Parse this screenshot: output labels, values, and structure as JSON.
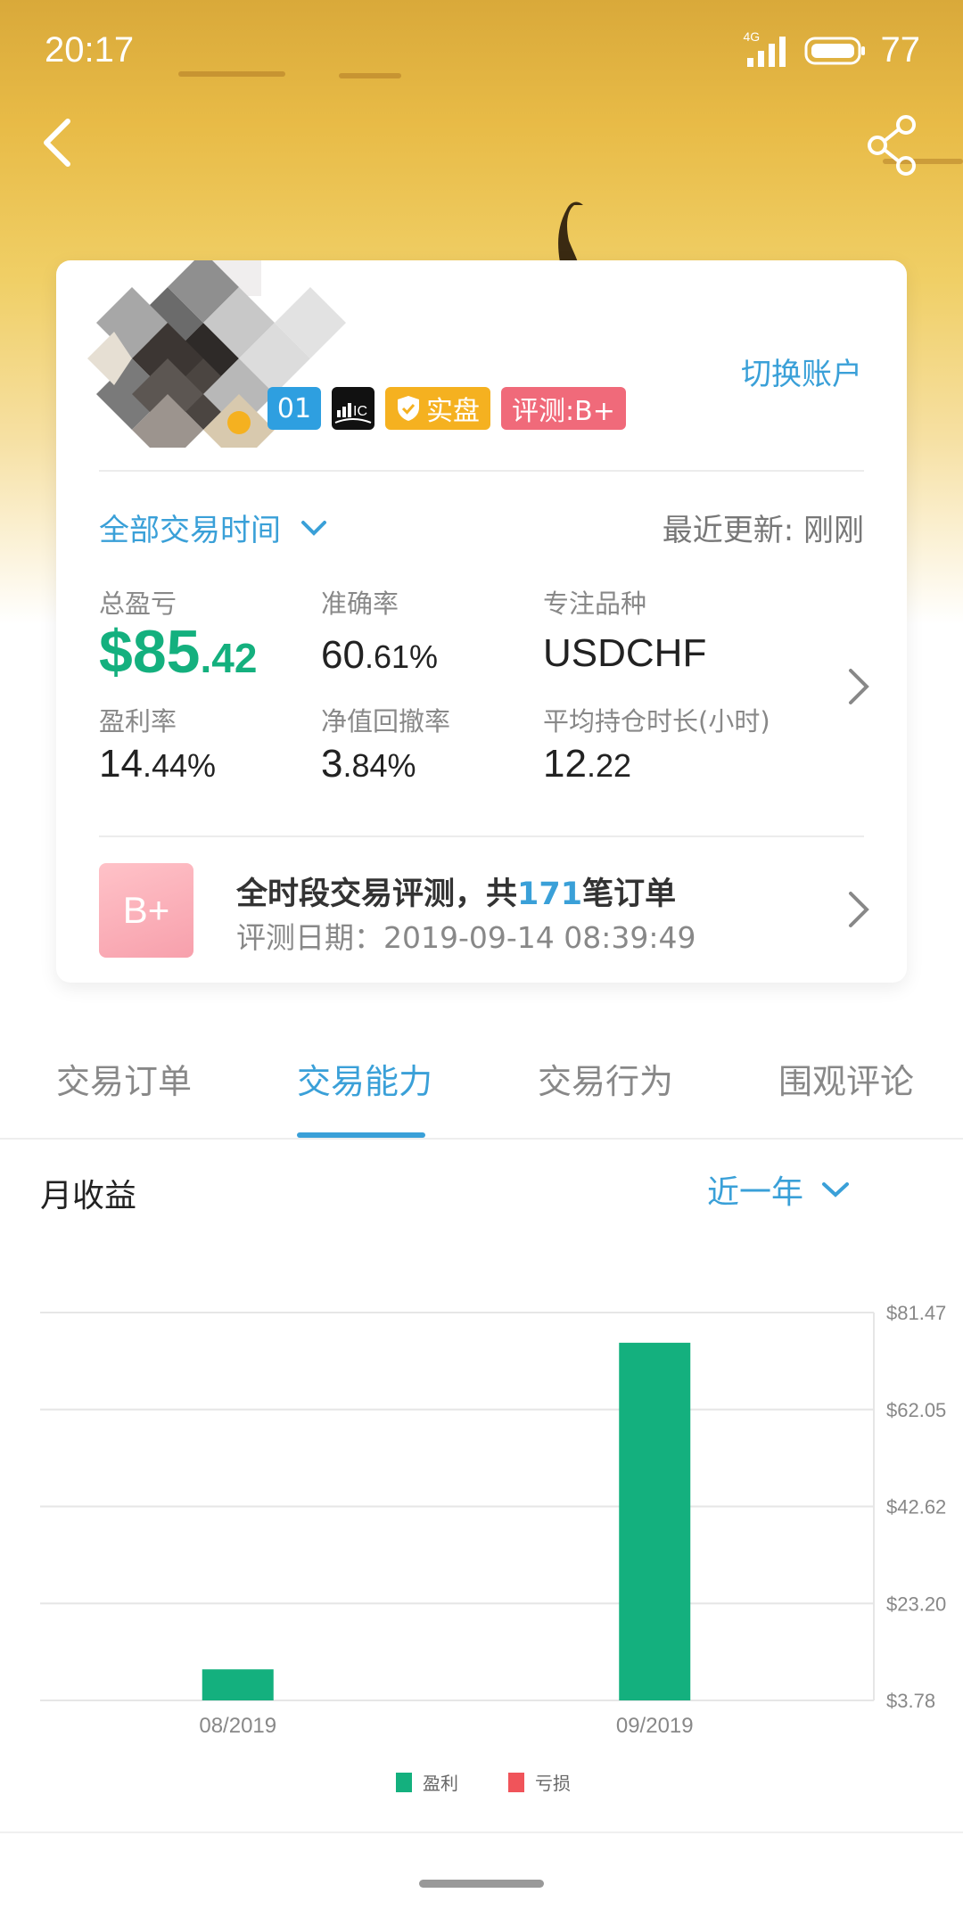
{
  "status": {
    "time": "20:17",
    "network": "4G",
    "battery": "77"
  },
  "account": {
    "badges": {
      "level": "01",
      "broker": "IC",
      "real": "实盘",
      "rating": "评测:B+"
    },
    "switch_label": "切换账户"
  },
  "filter": {
    "time_range": "全部交易时间",
    "last_update": "最近更新: 刚刚"
  },
  "stats": {
    "total_pl": {
      "label": "总盈亏",
      "int": "$85",
      "dec": ".42"
    },
    "accuracy": {
      "label": "准确率",
      "int": "60",
      "dec": ".61%"
    },
    "focus_symbol": {
      "label": "专注品种",
      "value": "USDCHF"
    },
    "profit_rate": {
      "label": "盈利率",
      "int": "14",
      "dec": ".44%"
    },
    "drawdown": {
      "label": "净值回撤率",
      "int": "3",
      "dec": ".84%"
    },
    "avg_hold": {
      "label": "平均持仓时长(小时)",
      "int": "12",
      "dec": ".22"
    }
  },
  "evaluation": {
    "grade": "B+",
    "title_prefix": "全时段交易评测，共",
    "order_count": "171",
    "title_suffix": "笔订单",
    "date": "评测日期：2019-09-14 08:39:49"
  },
  "tabs": [
    "交易订单",
    "交易能力",
    "交易行为",
    "围观评论"
  ],
  "active_tab": 1,
  "section": {
    "title": "月收益",
    "range": "近一年"
  },
  "colors": {
    "accent": "#3aa0d8",
    "profit": "#14b07e",
    "loss": "#f0545a"
  },
  "chart_data": {
    "type": "bar",
    "categories": [
      "08/2019",
      "09/2019"
    ],
    "series": [
      {
        "name": "盈利",
        "values": [
          10.0,
          75.42
        ]
      },
      {
        "name": "亏损",
        "values": [
          0,
          0
        ]
      }
    ],
    "y_ticks": [
      "$3.78",
      "$23.20",
      "$42.62",
      "$62.05",
      "$81.47"
    ],
    "ylim": [
      3.78,
      81.47
    ],
    "legend": "bottom-center",
    "grid": true
  }
}
